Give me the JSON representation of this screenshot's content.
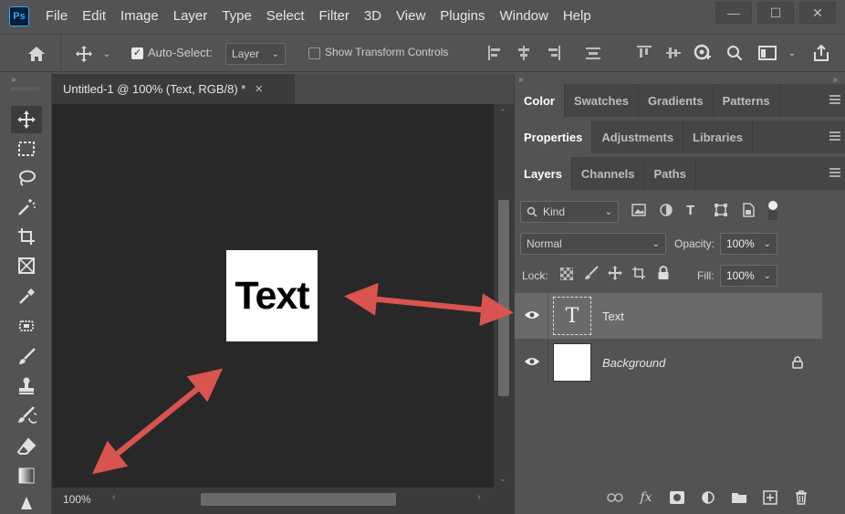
{
  "app": {
    "logo": "Ps",
    "menus": [
      "File",
      "Edit",
      "Image",
      "Layer",
      "Type",
      "Select",
      "Filter",
      "3D",
      "View",
      "Plugins",
      "Window",
      "Help"
    ]
  },
  "window_controls": {
    "minimize": "—",
    "maximize": "☐",
    "close": "✕"
  },
  "options_bar": {
    "auto_select_label": "Auto-Select:",
    "auto_select_checked": true,
    "auto_select_target": "Layer",
    "show_transform_label": "Show Transform Controls",
    "show_transform_checked": false
  },
  "document": {
    "tab_title": "Untitled-1 @ 100% (Text, RGB/8) *",
    "close_glyph": "×",
    "canvas_text": "Text",
    "zoom": "100%"
  },
  "panels": {
    "group1": [
      "Color",
      "Swatches",
      "Gradients",
      "Patterns"
    ],
    "group2": [
      "Properties",
      "Adjustments",
      "Libraries"
    ],
    "group3": [
      "Layers",
      "Channels",
      "Paths"
    ]
  },
  "layers_panel": {
    "filter_kind": "Kind",
    "blend_mode": "Normal",
    "opacity_label": "Opacity:",
    "opacity": "100%",
    "lock_label": "Lock:",
    "fill_label": "Fill:",
    "fill": "100%",
    "layers": [
      {
        "name": "Text",
        "type": "text",
        "selected": true
      },
      {
        "name": "Background",
        "type": "background",
        "locked": true
      }
    ]
  },
  "colors": {
    "accent_arrow": "#d9534f"
  }
}
